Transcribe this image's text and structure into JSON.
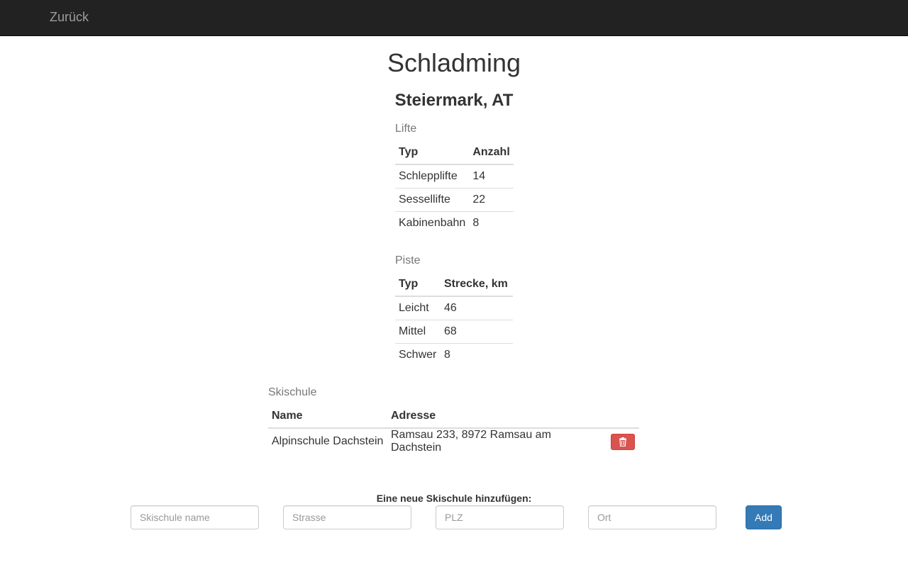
{
  "navbar": {
    "back_label": "Zurück",
    "background": "#222222",
    "link_color": "#9d9d9d"
  },
  "page": {
    "title": "Schladming",
    "subtitle": "Steiermark, AT"
  },
  "lifts": {
    "label": "Lifte",
    "headers": [
      "Typ",
      "Anzahl"
    ],
    "rows": [
      [
        "Schlepplifte",
        "14"
      ],
      [
        "Sessellifte",
        "22"
      ],
      [
        "Kabinenbahn",
        "8"
      ]
    ]
  },
  "slopes": {
    "label": "Piste",
    "headers": [
      "Typ",
      "Strecke, km"
    ],
    "rows": [
      [
        "Leicht",
        "46"
      ],
      [
        "Mittel",
        "68"
      ],
      [
        "Schwer",
        "8"
      ]
    ]
  },
  "schools": {
    "label": "Skischule",
    "headers": [
      "Name",
      "Adresse"
    ],
    "rows": [
      [
        "Alpinschule Dachstein",
        "Ramsau 233, 8972 Ramsau am Dachstein"
      ]
    ],
    "delete_icon": "trash-icon",
    "delete_color": "#d9534f"
  },
  "add_form": {
    "heading": "Eine neue Skischule hinzufügen:",
    "name_placeholder": "Skischule name",
    "street_placeholder": "Strasse",
    "zip_placeholder": "PLZ",
    "city_placeholder": "Ort",
    "add_label": "Add",
    "add_color": "#337ab7"
  }
}
